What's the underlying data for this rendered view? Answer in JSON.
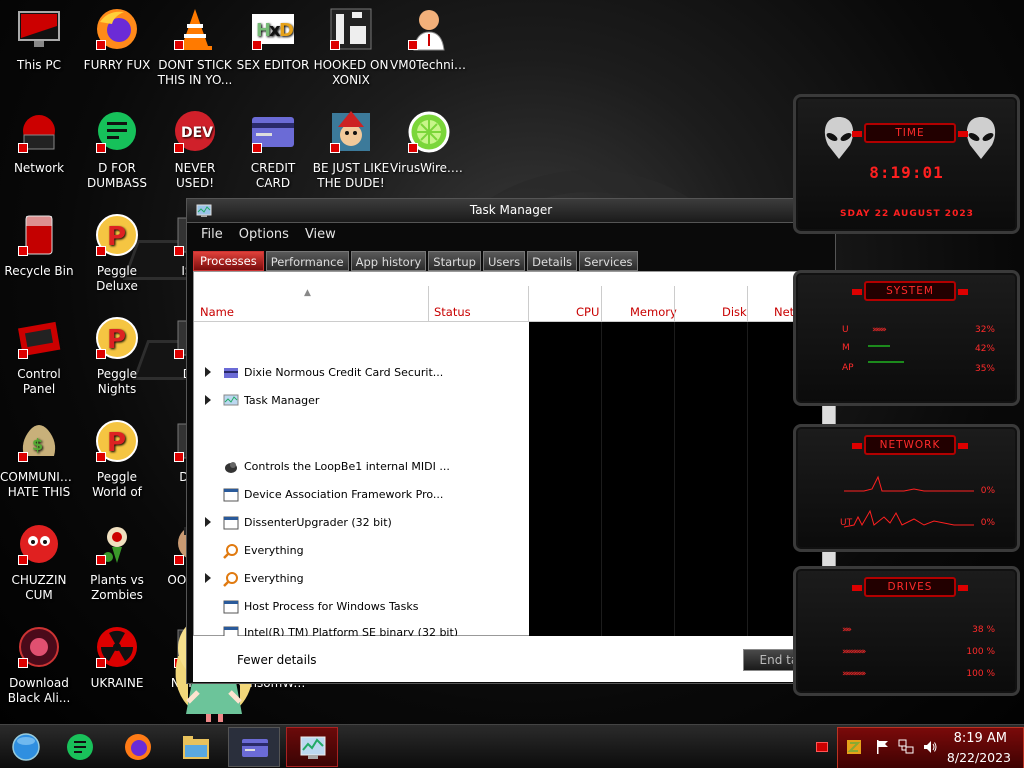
{
  "desktop_icons": [
    {
      "label": "This PC",
      "icon": "monitor-icon"
    },
    {
      "label": "FURRY FUX",
      "icon": "firefox-icon"
    },
    {
      "label": "DONT STICK THIS IN YO...",
      "icon": "vlc-cone-icon"
    },
    {
      "label": "SEX EDITOR",
      "icon": "hxd-icon"
    },
    {
      "label": "HOOKED ON XONIX",
      "icon": "xonix-icon"
    },
    {
      "label": "VM0Technic...",
      "icon": "doctor-icon"
    },
    {
      "label": "Network",
      "icon": "network-icon"
    },
    {
      "label": "D FOR DUMBASS",
      "icon": "discord-icon"
    },
    {
      "label": "NEVER USED!",
      "icon": "dev-icon"
    },
    {
      "label": "CREDIT CARD CHECKER",
      "icon": "credit-card-icon"
    },
    {
      "label": "BE JUST LIKE THE DUDE!",
      "icon": "elf-icon"
    },
    {
      "label": "VirusWire.exe",
      "icon": "limewire-icon"
    },
    {
      "label": "Recycle Bin",
      "icon": "recycle-bin-icon"
    },
    {
      "label": "Peggle Deluxe",
      "icon": "peggle-icon"
    },
    {
      "label": "ISRA",
      "icon": "app-icon"
    },
    {
      "label": "Control Panel",
      "icon": "control-panel-icon"
    },
    {
      "label": "Peggle Nights Deluxe",
      "icon": "peggle-icon"
    },
    {
      "label": "DEE",
      "icon": "app-icon"
    },
    {
      "label": "COMMUNISTS HATE THIS G...",
      "icon": "money-bag-icon"
    },
    {
      "label": "Peggle World of Warcraft ...",
      "icon": "peggle-icon"
    },
    {
      "label": "DIE P",
      "icon": "app-icon"
    },
    {
      "label": "CHUZZIN CUM",
      "icon": "chuzzle-icon"
    },
    {
      "label": "Plants vs Zombies",
      "icon": "plant-icon"
    },
    {
      "label": "OOPS DC",
      "icon": "face-icon"
    },
    {
      "label": "Download Black Ali...",
      "icon": "alien-orb-icon"
    },
    {
      "label": "UKRAINE",
      "icon": "radiation-icon"
    },
    {
      "label": "NCHING",
      "icon": "app-icon"
    },
    {
      "label": "RansomWar...",
      "icon": "app-icon"
    }
  ],
  "task_manager": {
    "title": "Task Manager",
    "menu": [
      "File",
      "Options",
      "View"
    ],
    "tabs": [
      "Processes",
      "Performance",
      "App history",
      "Startup",
      "Users",
      "Details",
      "Services"
    ],
    "active_tab": "Processes",
    "columns": {
      "name": "Name",
      "status": "Status",
      "cpu": "CPU",
      "memory": "Memory",
      "disk": "Disk",
      "network": "Network"
    },
    "rows": [
      {
        "name": "Dixie Normous Credit Card Securit...",
        "expandable": true,
        "icon": "card-icon"
      },
      {
        "name": "Task Manager",
        "expandable": true,
        "icon": "taskmgr-icon"
      },
      {
        "name": "Controls the LoopBe1 internal MIDI ...",
        "expandable": false,
        "icon": "midi-icon"
      },
      {
        "name": "Device Association Framework Pro...",
        "expandable": false,
        "icon": "window-icon"
      },
      {
        "name": "DissenterUpgrader (32 bit)",
        "expandable": true,
        "icon": "window-icon"
      },
      {
        "name": "Everything",
        "expandable": false,
        "icon": "magnifier-icon"
      },
      {
        "name": "Everything",
        "expandable": true,
        "icon": "magnifier-icon"
      },
      {
        "name": "Host Process for Windows Tasks",
        "expandable": false,
        "icon": "window-icon"
      },
      {
        "name": "Intel(R) TM) Platform SE binary (32 bit)",
        "expandable": false,
        "icon": "window-icon"
      }
    ],
    "fewer_details": "Fewer details",
    "end_task": "End task"
  },
  "gadgets": {
    "time": {
      "title": "TIME",
      "clock": "8:19:01",
      "date": "SDAY 22 AUGUST 2023"
    },
    "system": {
      "title": "SYSTEM",
      "labels": [
        "U",
        "M",
        "AP"
      ],
      "values": [
        "32%",
        "42%",
        "35%"
      ]
    },
    "network": {
      "title": "NETWORK",
      "labels": [
        "",
        "UT"
      ],
      "values": [
        "0%",
        "0%"
      ]
    },
    "drives": {
      "title": "DRIVES",
      "values": [
        "38 %",
        "100 %",
        "100 %"
      ]
    }
  },
  "taskbar": {
    "apps": [
      "start-orb-icon",
      "discord-icon",
      "firefox-icon",
      "file-explorer-icon",
      "credit-card-icon",
      "taskmgr-icon"
    ],
    "time": "8:19 AM",
    "date": "8/22/2023"
  },
  "colors": {
    "accent": "#d00000",
    "text": "#ffffff",
    "header_text": "#c80000"
  }
}
